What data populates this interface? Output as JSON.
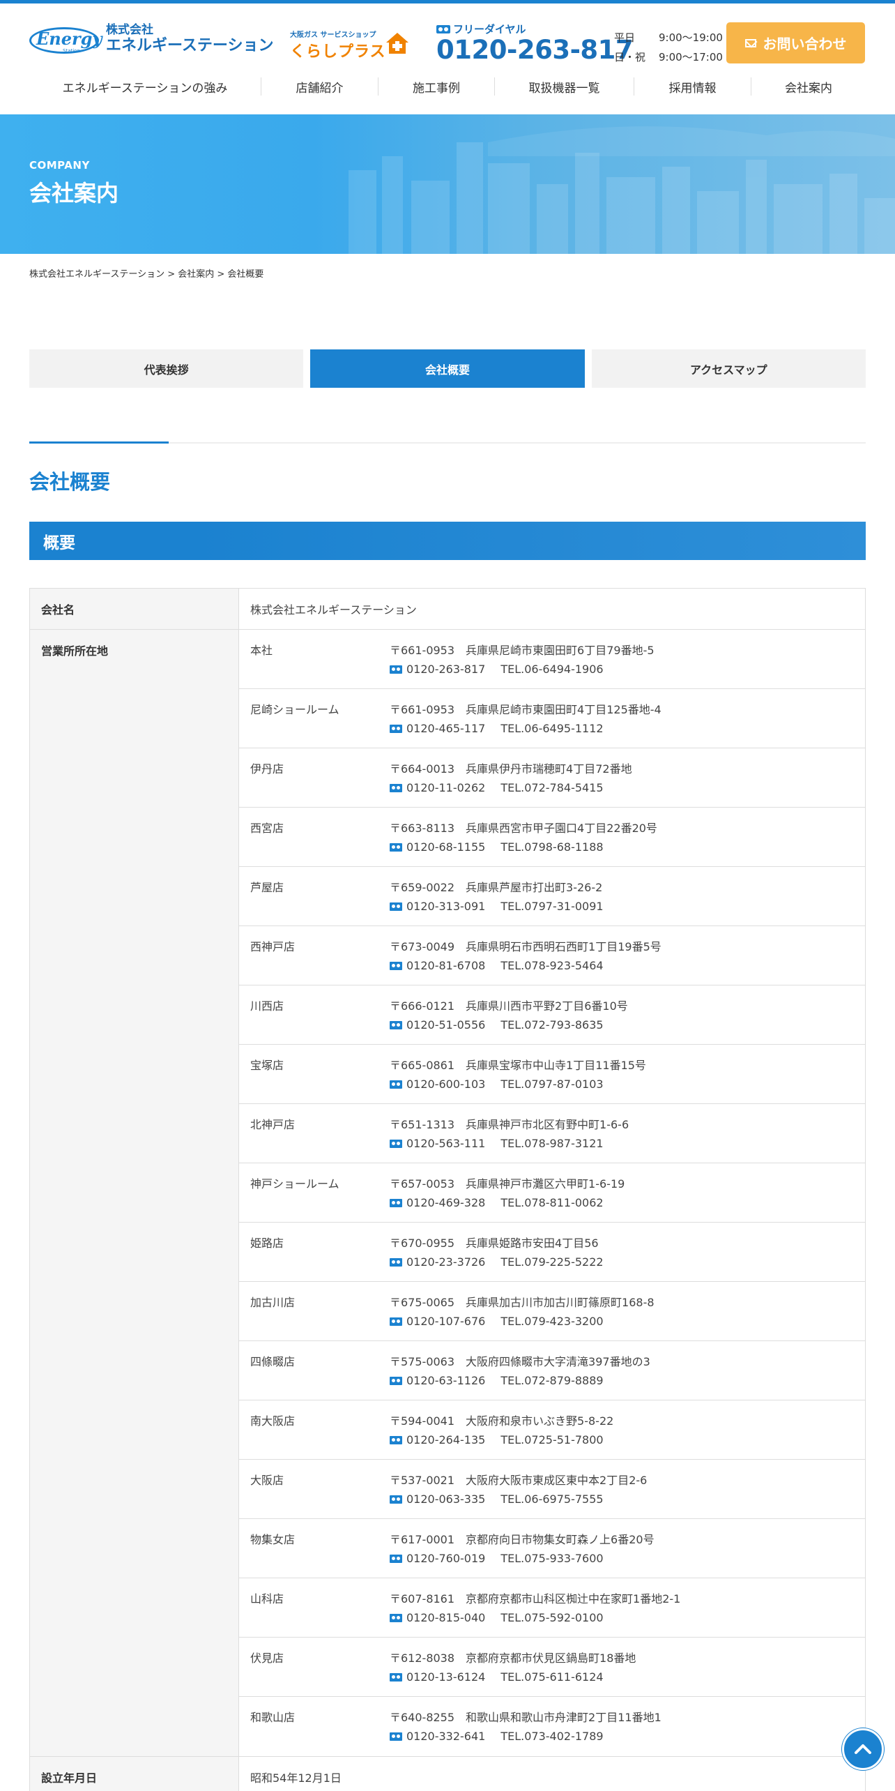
{
  "header": {
    "logo_text": "Energy",
    "logo_sub": "Station",
    "company_l1": "株式会社",
    "company_l2": "エネルギーステーション",
    "shop_small": "大阪ガス サービスショップ",
    "shop_big": "くらしプラス",
    "freedial_label": "フリーダイヤル",
    "freedial_number": "0120-263-817",
    "hours": [
      {
        "day": "平日",
        "time": "9:00〜19:00"
      },
      {
        "day": "日・祝",
        "time": "9:00〜17:00"
      }
    ],
    "contact_label": "お問い合わせ"
  },
  "nav": [
    "エネルギーステーションの強み",
    "店舗紹介",
    "施工事例",
    "取扱機器一覧",
    "採用情報",
    "会社案内"
  ],
  "hero": {
    "en": "COMPANY",
    "jp": "会社案内"
  },
  "breadcrumb": "株式会社エネルギーステーション > 会社案内 > 会社概要",
  "tabs": [
    {
      "label": "代表挨拶",
      "active": false
    },
    {
      "label": "会社概要",
      "active": true
    },
    {
      "label": "アクセスマップ",
      "active": false
    }
  ],
  "section_title": "会社概要",
  "bar_title": "概要",
  "table": {
    "company_label": "会社名",
    "company_value": "株式会社エネルギーステーション",
    "offices_label": "営業所所在地",
    "established_label": "設立年月日",
    "established_value": "昭和54年12月1日"
  },
  "branches": [
    {
      "name": "本社",
      "addr": "〒661-0953　兵庫県尼崎市東園田町6丁目79番地-5",
      "free": "0120-263-817",
      "tel": "TEL.06-6494-1906"
    },
    {
      "name": "尼崎ショールーム",
      "addr": "〒661-0953　兵庫県尼崎市東園田町4丁目125番地-4",
      "free": "0120-465-117",
      "tel": "TEL.06-6495-1112"
    },
    {
      "name": "伊丹店",
      "addr": "〒664-0013　兵庫県伊丹市瑞穂町4丁目72番地",
      "free": "0120-11-0262",
      "tel": "TEL.072-784-5415"
    },
    {
      "name": "西宮店",
      "addr": "〒663-8113　兵庫県西宮市甲子園口4丁目22番20号",
      "free": "0120-68-1155",
      "tel": "TEL.0798-68-1188"
    },
    {
      "name": "芦屋店",
      "addr": "〒659-0022　兵庫県芦屋市打出町3-26-2",
      "free": "0120-313-091",
      "tel": "TEL.0797-31-0091"
    },
    {
      "name": "西神戸店",
      "addr": "〒673-0049　兵庫県明石市西明石西町1丁目19番5号",
      "free": "0120-81-6708",
      "tel": "TEL.078-923-5464"
    },
    {
      "name": "川西店",
      "addr": "〒666-0121　兵庫県川西市平野2丁目6番10号",
      "free": "0120-51-0556",
      "tel": "TEL.072-793-8635"
    },
    {
      "name": "宝塚店",
      "addr": "〒665-0861　兵庫県宝塚市中山寺1丁目11番15号",
      "free": "0120-600-103",
      "tel": "TEL.0797-87-0103"
    },
    {
      "name": "北神戸店",
      "addr": "〒651-1313　兵庫県神戸市北区有野中町1-6-6",
      "free": "0120-563-111",
      "tel": "TEL.078-987-3121"
    },
    {
      "name": "神戸ショールーム",
      "addr": "〒657-0053　兵庫県神戸市灘区六甲町1-6-19",
      "free": "0120-469-328",
      "tel": "TEL.078-811-0062"
    },
    {
      "name": "姫路店",
      "addr": "〒670-0955　兵庫県姫路市安田4丁目56",
      "free": "0120-23-3726",
      "tel": "TEL.079-225-5222"
    },
    {
      "name": "加古川店",
      "addr": "〒675-0065　兵庫県加古川市加古川町篠原町168-8",
      "free": "0120-107-676",
      "tel": "TEL.079-423-3200"
    },
    {
      "name": "四條畷店",
      "addr": "〒575-0063　大阪府四條畷市大字清滝397番地の3",
      "free": "0120-63-1126",
      "tel": "TEL.072-879-8889"
    },
    {
      "name": "南大阪店",
      "addr": "〒594-0041　大阪府和泉市いぶき野5-8-22",
      "free": "0120-264-135",
      "tel": "TEL.0725-51-7800"
    },
    {
      "name": "大阪店",
      "addr": "〒537-0021　大阪府大阪市東成区東中本2丁目2-6",
      "free": "0120-063-335",
      "tel": "TEL.06-6975-7555"
    },
    {
      "name": "物集女店",
      "addr": "〒617-0001　京都府向日市物集女町森ノ上6番20号",
      "free": "0120-760-019",
      "tel": "TEL.075-933-7600"
    },
    {
      "name": "山科店",
      "addr": "〒607-8161　京都府京都市山科区椥辻中在家町1番地2-1",
      "free": "0120-815-040",
      "tel": "TEL.075-592-0100"
    },
    {
      "name": "伏見店",
      "addr": "〒612-8038　京都府京都市伏見区鍋島町18番地",
      "free": "0120-13-6124",
      "tel": "TEL.075-611-6124"
    },
    {
      "name": "和歌山店",
      "addr": "〒640-8255　和歌山県和歌山市舟津町2丁目11番地1",
      "free": "0120-332-641",
      "tel": "TEL.073-402-1789"
    }
  ],
  "colors": {
    "primary": "#1b82d0",
    "accent": "#f7b549",
    "orange": "#f08200"
  },
  "icons": [
    "freedial-icon",
    "mail-icon",
    "house-icon",
    "chevron-up-icon"
  ]
}
